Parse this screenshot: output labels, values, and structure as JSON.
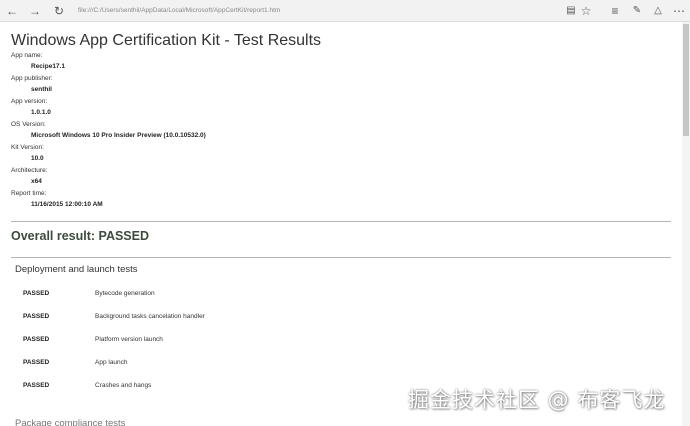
{
  "browser": {
    "address": "file:///C:/Users/senthil/AppData/Local/Microsoft/AppCertKit/report1.htm",
    "icons": [
      "back-icon",
      "forward-icon",
      "refresh-icon",
      "reading-view-icon",
      "favorite-star-icon",
      "hub-icon",
      "web-note-icon",
      "share-icon",
      "more-icon"
    ]
  },
  "report": {
    "title": "Windows App Certification Kit - Test Results",
    "fields": [
      {
        "label": "App name:",
        "value": "Recipe17.1"
      },
      {
        "label": "App publisher:",
        "value": "senthil"
      },
      {
        "label": "App version:",
        "value": "1.0.1.0"
      },
      {
        "label": "OS Version:",
        "value": "Microsoft Windows 10 Pro Insider Preview (10.0.10532.0)"
      },
      {
        "label": "Kit Version:",
        "value": "10.0"
      },
      {
        "label": "Architecture:",
        "value": "x64"
      },
      {
        "label": "Report time:",
        "value": "11/16/2015 12:00:10 AM"
      }
    ],
    "overall": "Overall result: PASSED",
    "section": "Deployment and launch tests",
    "tests": [
      {
        "status": "PASSED",
        "name": "Bytecode generation"
      },
      {
        "status": "PASSED",
        "name": "Background tasks cancelation handler"
      },
      {
        "status": "PASSED",
        "name": "Platform version launch"
      },
      {
        "status": "PASSED",
        "name": "App launch"
      },
      {
        "status": "PASSED",
        "name": "Crashes and hangs"
      }
    ],
    "next_section_partial": "Package compliance tests"
  },
  "watermark": "掘金技术社区 @ 布客飞龙"
}
